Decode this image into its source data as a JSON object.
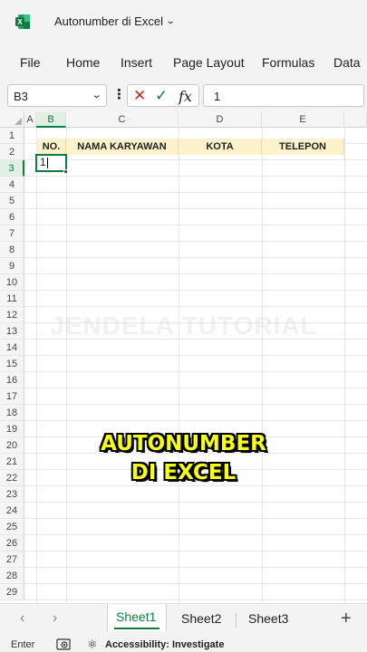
{
  "window": {
    "title": "Autonumber di Excel",
    "app_icon": "excel-icon"
  },
  "ribbon": {
    "tabs": [
      "File",
      "Home",
      "Insert",
      "Page Layout",
      "Formulas",
      "Data"
    ]
  },
  "formula_bar": {
    "name_box": "B3",
    "formula_value": "1",
    "fx_label": "fx"
  },
  "sheet": {
    "columns": [
      "A",
      "B",
      "C",
      "D",
      "E"
    ],
    "rows": [
      "1",
      "2",
      "3",
      "4",
      "5",
      "6",
      "7",
      "8",
      "9",
      "10",
      "11",
      "12",
      "13",
      "14",
      "15",
      "16",
      "17",
      "18",
      "19",
      "20",
      "21",
      "22",
      "23",
      "24",
      "25",
      "26",
      "27",
      "28",
      "29"
    ],
    "headers": {
      "no": "NO.",
      "nama": "NAMA KARYAWAN",
      "kota": "KOTA",
      "telepon": "TELEPON"
    },
    "active_cell_value": "1",
    "header_fill_color": "#fdf2cc",
    "accent_color": "#107c41"
  },
  "watermark": "JENDELA TUTORIAL",
  "overlay_caption": {
    "line1": "AUTONUMBER",
    "line2": "DI EXCEL",
    "color": "#f7ff17"
  },
  "sheet_tabs": {
    "tabs": [
      "Sheet1",
      "Sheet2",
      "Sheet3"
    ],
    "active": "Sheet1",
    "prev_icon": "chevron-left-icon",
    "next_icon": "chevron-right-icon",
    "add_icon": "plus-icon"
  },
  "status_bar": {
    "mode": "Enter",
    "accessibility": "Accessibility: Investigate"
  }
}
